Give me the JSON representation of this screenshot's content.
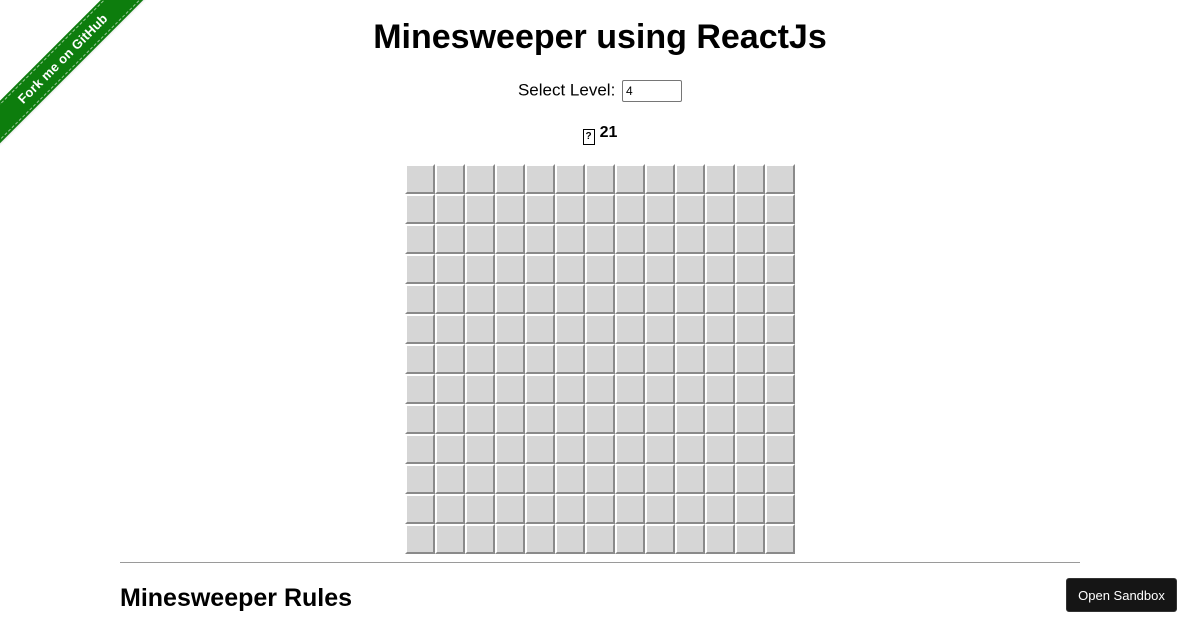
{
  "ribbon": {
    "label": "Fork me on GitHub",
    "color": "#0d7d0d"
  },
  "header": {
    "title": "Minesweeper using ReactJs"
  },
  "level": {
    "label": "Select Level:",
    "value": "4"
  },
  "status": {
    "flag_icon": "flag-icon",
    "mines_remaining": "21"
  },
  "board": {
    "rows": 13,
    "cols": 13,
    "cell_color": "#d6d6d6",
    "cell_state": "unrevealed"
  },
  "rules": {
    "heading": "Minesweeper Rules"
  },
  "sandbox": {
    "label": "Open Sandbox"
  }
}
